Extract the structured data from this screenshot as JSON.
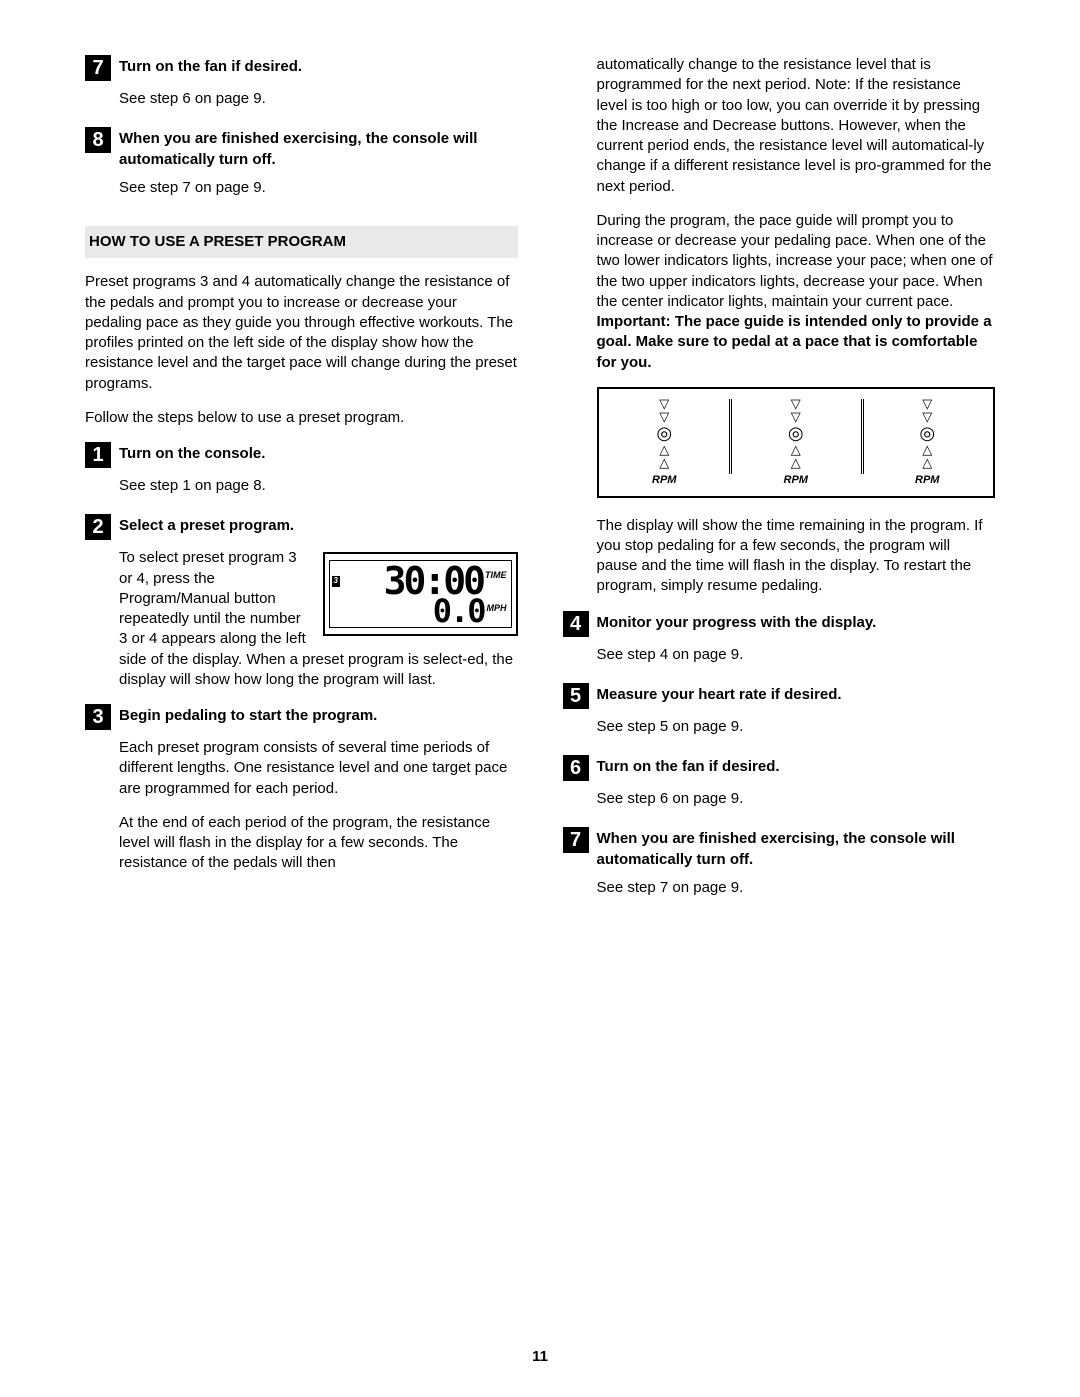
{
  "page_number": "11",
  "left": {
    "step7_num": "7",
    "step7_title": "Turn on the fan if desired.",
    "step7_body": "See step 6 on page 9.",
    "step8_num": "8",
    "step8_title": "When you are finished exercising, the console will automatically turn off.",
    "step8_body": "See step 7 on page 9.",
    "section_head": "HOW TO USE A PRESET PROGRAM",
    "intro_p1": "Preset programs 3 and 4 automatically change the resistance of the pedals and prompt you to increase or decrease your pedaling pace as they guide you through effective workouts. The profiles printed on the left side of the display show how the resistance level and the target pace will change during the preset programs.",
    "intro_p2": "Follow the steps below to use a preset program.",
    "s1_num": "1",
    "s1_title": "Turn on the console.",
    "s1_body": "See step 1 on page 8.",
    "s2_num": "2",
    "s2_title": "Select a preset program.",
    "s2_body_a": "To select preset program 3 or 4, press the Program/Manual button repeatedly until the number 3 or 4 appears along the left side",
    "s2_body_b": "of the display. When a preset program is select-ed, the display will show how long the program will last.",
    "s3_num": "3",
    "s3_title": "Begin pedaling to start the program.",
    "s3_body_a": "Each preset program consists of several time periods of different lengths. One resistance level and one target pace are programmed for each period.",
    "s3_body_b": "At the end of each period of the program, the resistance level will flash in the display for a few seconds. The resistance of the pedals will then",
    "lcd": {
      "indicator": "3",
      "time_value": "30:00",
      "time_label": "TIME",
      "mph_value": "0.0",
      "mph_label": "MPH"
    }
  },
  "right": {
    "cont_p1": "automatically change to the resistance level that is programmed for the next period. Note: If the resistance level is too high or too low, you can override it by pressing the Increase and Decrease buttons. However, when the current period ends, the resistance level will automatical-ly change if a different resistance level is pro-grammed for the next period.",
    "cont_p2a": "During the program, the pace guide will prompt you to increase or decrease your pedaling pace. When one of the two lower indicators lights, increase your pace; when one of the two upper indicators lights, decrease your pace. When the center indicator lights, maintain your current pace. ",
    "cont_p2b": "Important: The pace guide is intended only to provide a goal. Make sure to pedal at a pace that is comfortable for you.",
    "pace_rpm": "RPM",
    "cont_p3": "The display will show the time remaining in the program. If you stop pedaling for a few seconds, the program will pause and the time will flash in the display. To restart the program, simply resume pedaling.",
    "s4_num": "4",
    "s4_title": "Monitor your progress with the display.",
    "s4_body": "See step 4 on page 9.",
    "s5_num": "5",
    "s5_title": "Measure your heart rate if desired.",
    "s5_body": "See step 5 on page 9.",
    "s6_num": "6",
    "s6_title": "Turn on the fan if desired.",
    "s6_body": "See step 6 on page 9.",
    "s7_num": "7",
    "s7_title": "When you are finished exercising, the console will automatically turn off.",
    "s7_body": "See step 7 on page 9."
  }
}
